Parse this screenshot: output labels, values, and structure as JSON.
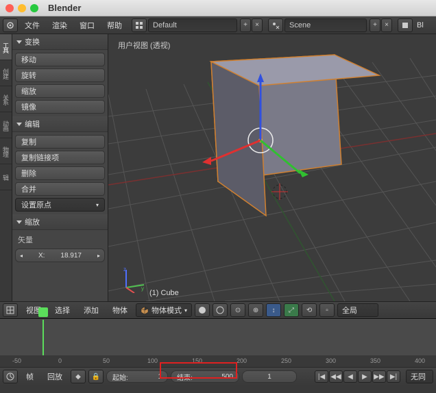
{
  "title": "Blender",
  "menubar": {
    "items": [
      "文件",
      "渲染",
      "窗口",
      "帮助"
    ],
    "layout_field": "Default",
    "scene_field": "Scene",
    "right_label": "Bl"
  },
  "vtabs": [
    "工具",
    "创建",
    "关系",
    "动画",
    "物理",
    "辑"
  ],
  "tool_panel": {
    "transform": {
      "header": "变换",
      "move": "移动",
      "rotate": "旋转",
      "scale": "缩放",
      "mirror": "镜像"
    },
    "edit": {
      "header": "编辑",
      "duplicate": "复制",
      "duplicate_linked": "复制链接项",
      "delete": "删除",
      "join": "合并",
      "set_origin": "设置原点"
    },
    "scale_panel": {
      "header": "缩放",
      "vector_label": "矢量",
      "x_label": "X:",
      "x_value": "18.917"
    }
  },
  "viewport": {
    "label": "用户视图 (透视)",
    "object_label": "(1) Cube"
  },
  "vp_header": {
    "menus": [
      "视图",
      "选择",
      "添加",
      "物体"
    ],
    "mode": "物体模式",
    "overlay_label": "全局"
  },
  "timeline": {
    "ticks": [
      "-50",
      "0",
      "50",
      "100",
      "150",
      "200",
      "250",
      "300",
      "350",
      "400"
    ],
    "frame_label": "帧",
    "playback_label": "回放",
    "start_label": "起始:",
    "start_value": "1",
    "end_label": "结束:",
    "end_value": "500",
    "current_frame": "1",
    "nosync": "无同"
  }
}
